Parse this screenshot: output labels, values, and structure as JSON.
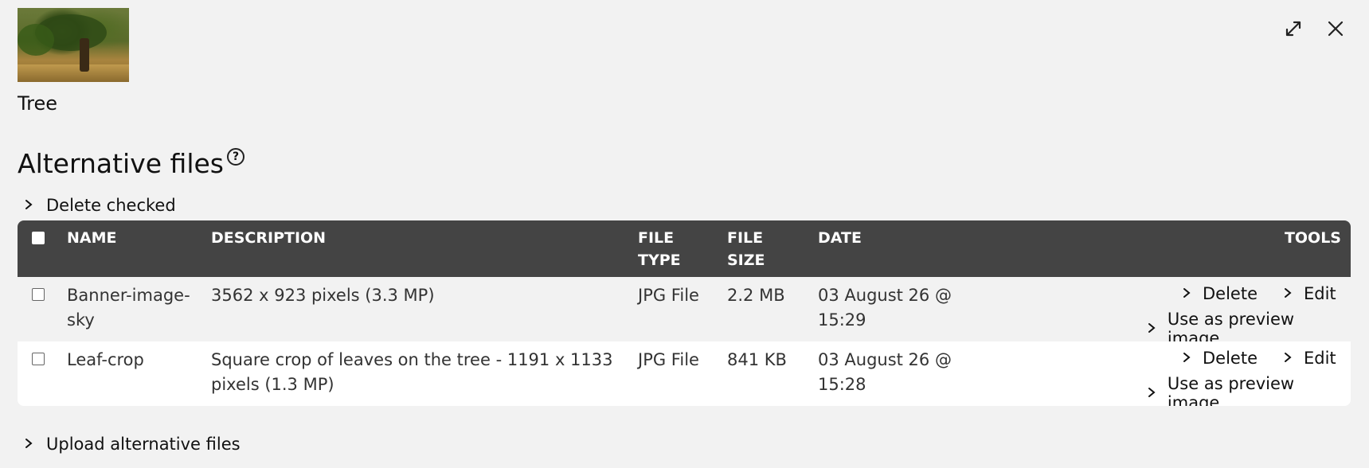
{
  "asset": {
    "title": "Tree",
    "thumbnail_icon": "tree-thumbnail-image"
  },
  "window": {
    "fullscreen_icon": "expand-icon",
    "close_icon": "close-icon"
  },
  "section": {
    "heading": "Alternative files",
    "help_icon": "help-icon",
    "help_glyph": "?"
  },
  "actions": {
    "delete_checked": "Delete checked",
    "upload": "Upload alternative files"
  },
  "table": {
    "headers": {
      "name": "NAME",
      "description": "DESCRIPTION",
      "file_type_1": "FILE",
      "file_type_2": "TYPE",
      "file_size_1": "FILE",
      "file_size_2": "SIZE",
      "date": "DATE",
      "tools": "TOOLS"
    },
    "rows": [
      {
        "name_1": "Banner-image-",
        "name_2": "sky",
        "description_1": "3562 x 923 pixels (3.3 MP)",
        "description_2": "",
        "file_type": "JPG File",
        "file_size": "2.2 MB",
        "date_1": "03 August 26 @",
        "date_2": "15:29",
        "tool_delete": "Delete",
        "tool_edit": "Edit",
        "tool_preview": "Use as preview image"
      },
      {
        "name_1": "Leaf-crop",
        "name_2": "",
        "description_1": "Square crop of leaves on the tree - 1191 x 1133",
        "description_2": "pixels (1.3 MP)",
        "file_type": "JPG File",
        "file_size": "841 KB",
        "date_1": "03 August 26 @",
        "date_2": "15:28",
        "tool_delete": "Delete",
        "tool_edit": "Edit",
        "tool_preview": "Use as preview image"
      }
    ]
  }
}
